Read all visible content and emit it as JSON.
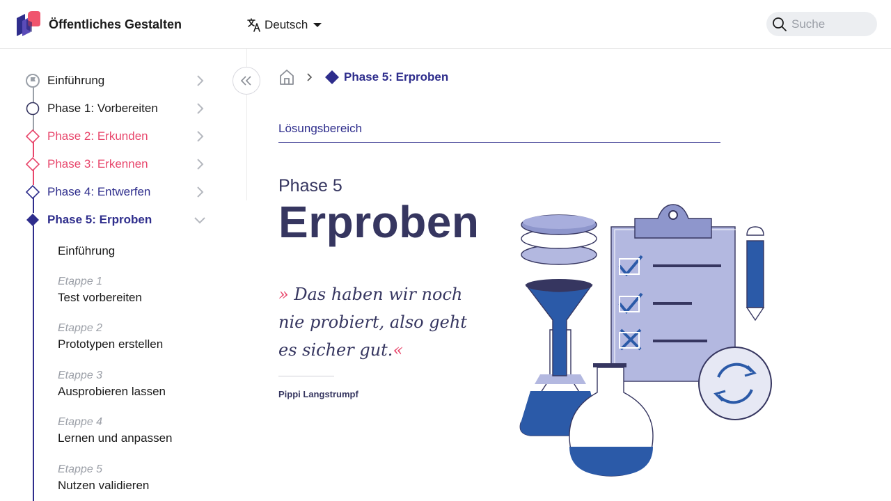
{
  "header": {
    "brand": "Öffentliches Gestalten",
    "language": "Deutsch",
    "search_placeholder": "Suche"
  },
  "sidebar": {
    "items": [
      {
        "label": "Einführung",
        "color": "#1a1a1a",
        "marker": "flag-icon"
      },
      {
        "label": "Phase 1: Vorbereiten",
        "color": "#1a1a1a",
        "marker": "circle-icon"
      },
      {
        "label": "Phase 2: Erkunden",
        "color": "#e8476c",
        "marker": "diamond-outline-icon"
      },
      {
        "label": "Phase 3: Erkennen",
        "color": "#e8476c",
        "marker": "diamond-outline-icon"
      },
      {
        "label": "Phase 4: Entwerfen",
        "color": "#2e2d8c",
        "marker": "diamond-outline-icon"
      },
      {
        "label": "Phase 5: Erproben",
        "color": "#2e2d8c",
        "marker": "diamond-filled-icon",
        "expanded": true
      }
    ],
    "subitems": [
      {
        "stage": "",
        "title": "Einführung"
      },
      {
        "stage": "Etappe 1",
        "title": "Test vorbereiten"
      },
      {
        "stage": "Etappe 2",
        "title": "Prototypen erstellen"
      },
      {
        "stage": "Etappe 3",
        "title": "Ausprobieren lassen"
      },
      {
        "stage": "Etappe 4",
        "title": "Lernen und anpassen"
      },
      {
        "stage": "Etappe 5",
        "title": "Nutzen validieren"
      }
    ]
  },
  "breadcrumb": {
    "current": "Phase 5: Erproben"
  },
  "main": {
    "section_label": "Lösungsbereich",
    "phase_number": "Phase 5",
    "phase_title": "Erproben",
    "quote_open": "»",
    "quote_text": " Das haben wir noch nie probiert, also geht es sicher gut.",
    "quote_close": "«",
    "quote_author": "Pippi Langstrumpf"
  },
  "colors": {
    "accent": "#2e2d8c",
    "pink": "#e8476c",
    "heading": "#363660",
    "illustration_blue": "#2b5aa8",
    "illustration_lavender": "#b3b8e0"
  }
}
